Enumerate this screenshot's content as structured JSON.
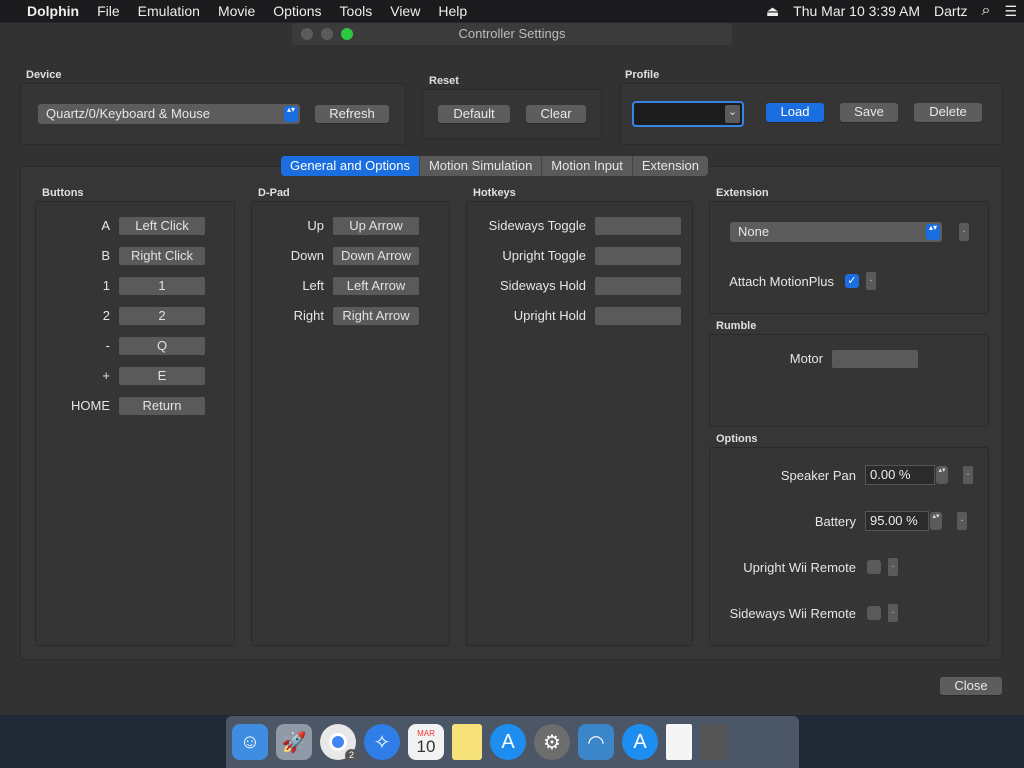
{
  "menubar": {
    "apple": "",
    "app": "Dolphin",
    "items": [
      "File",
      "Emulation",
      "Movie",
      "Options",
      "Tools",
      "View",
      "Help"
    ],
    "eject": "⏏",
    "clock": "Thu Mar 10  3:39 AM",
    "user": "Dartz",
    "search_icon": "⌕",
    "list_icon": "☰"
  },
  "window": {
    "title": "Controller Settings"
  },
  "device": {
    "title": "Device",
    "value": "Quartz/0/Keyboard & Mouse",
    "refresh": "Refresh"
  },
  "reset": {
    "title": "Reset",
    "default": "Default",
    "clear": "Clear"
  },
  "profile": {
    "title": "Profile",
    "value": "",
    "load": "Load",
    "save": "Save",
    "delete": "Delete"
  },
  "tabs": [
    "General and Options",
    "Motion Simulation",
    "Motion Input",
    "Extension"
  ],
  "buttons": {
    "title": "Buttons",
    "rows": [
      {
        "label": "A",
        "value": "Left Click"
      },
      {
        "label": "B",
        "value": "Right Click"
      },
      {
        "label": "1",
        "value": "1"
      },
      {
        "label": "2",
        "value": "2"
      },
      {
        "label": "-",
        "value": "Q"
      },
      {
        "label": "+",
        "value": "E"
      },
      {
        "label": "HOME",
        "value": "Return"
      }
    ]
  },
  "dpad": {
    "title": "D-Pad",
    "rows": [
      {
        "label": "Up",
        "value": "Up Arrow"
      },
      {
        "label": "Down",
        "value": "Down Arrow"
      },
      {
        "label": "Left",
        "value": "Left Arrow"
      },
      {
        "label": "Right",
        "value": "Right Arrow"
      }
    ]
  },
  "hotkeys": {
    "title": "Hotkeys",
    "rows": [
      {
        "label": "Sideways Toggle",
        "value": ""
      },
      {
        "label": "Upright Toggle",
        "value": ""
      },
      {
        "label": "Sideways Hold",
        "value": ""
      },
      {
        "label": "Upright Hold",
        "value": ""
      }
    ]
  },
  "extension": {
    "title": "Extension",
    "value": "None",
    "motionplus": "Attach MotionPlus",
    "motionplus_checked": true
  },
  "rumble": {
    "title": "Rumble",
    "motor": "Motor",
    "motor_value": ""
  },
  "options": {
    "title": "Options",
    "speaker_pan": "Speaker Pan",
    "speaker_pan_value": "0.00 %",
    "battery": "Battery",
    "battery_value": "95.00 %",
    "upright": "Upright Wii Remote",
    "sideways": "Sideways Wii Remote"
  },
  "close": "Close",
  "more": ".",
  "stepper_glyph": "▴▾",
  "check_glyph": "✓",
  "dropdown_glyph": "⌄",
  "dock": {
    "calendar_month": "MAR",
    "calendar_day": "10",
    "chrome_badge": "2"
  }
}
